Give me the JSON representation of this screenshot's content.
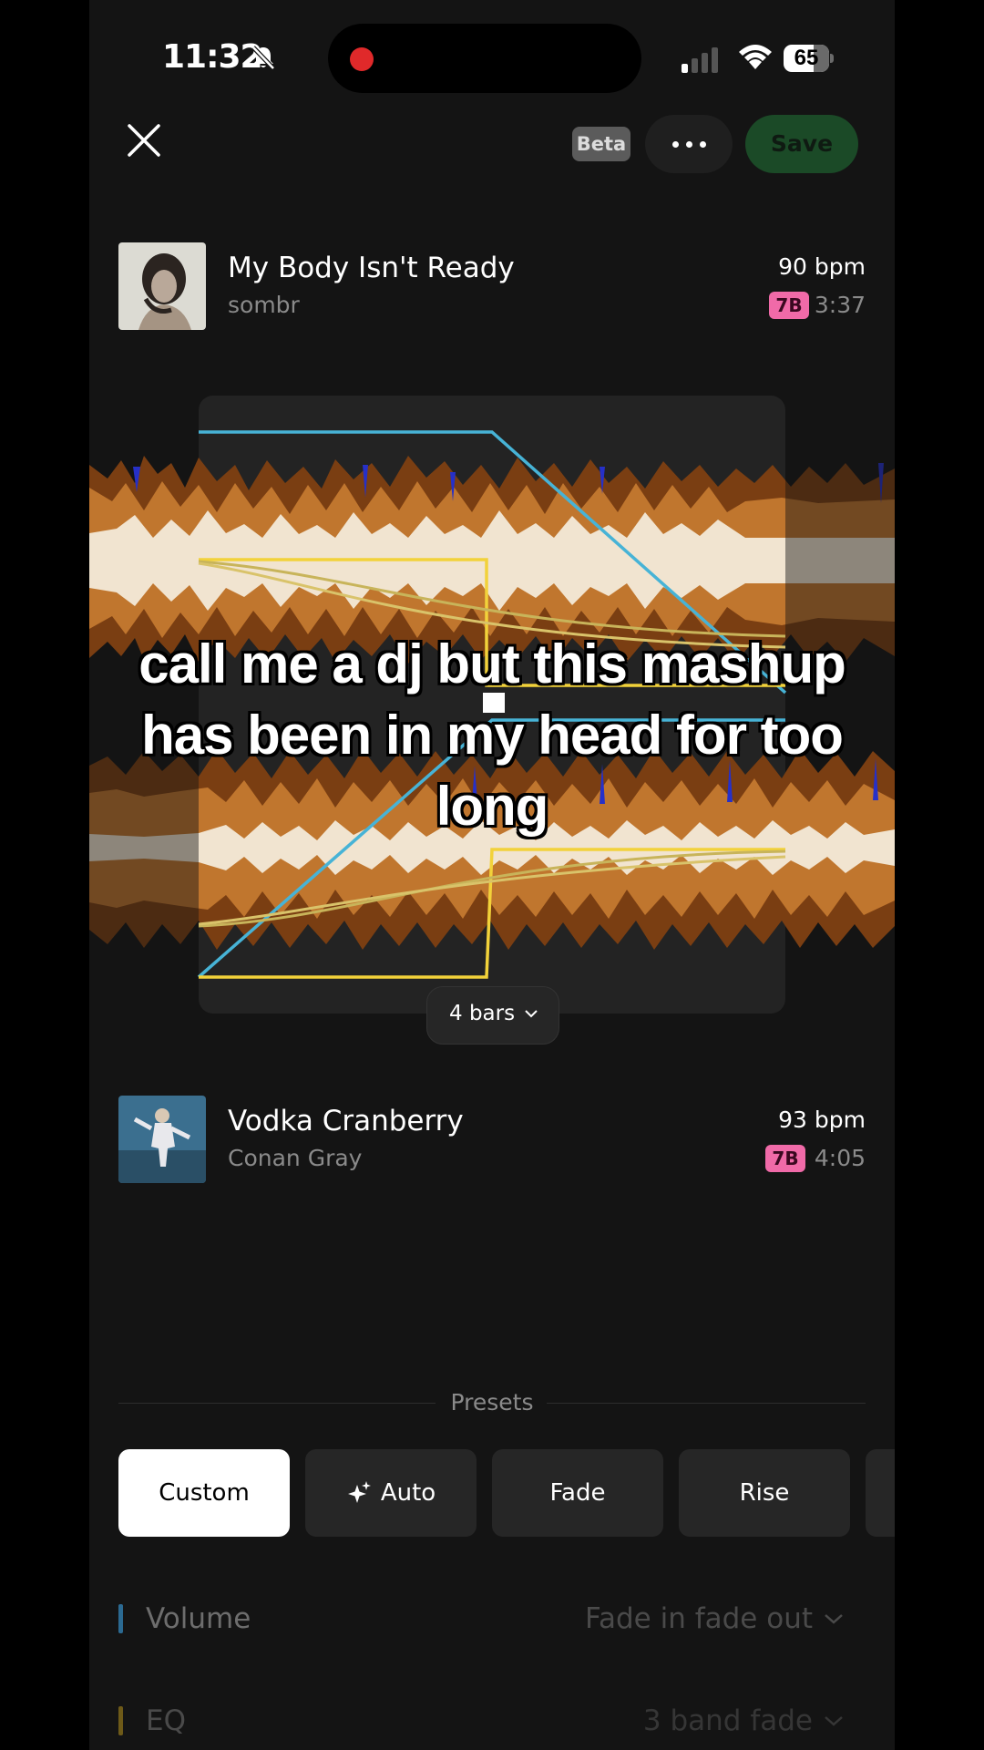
{
  "status_bar": {
    "time": "11:32",
    "battery": "65"
  },
  "toolbar": {
    "beta_label": "Beta",
    "save_label": "Save"
  },
  "tracks": [
    {
      "title": "My Body Isn't Ready",
      "artist": "sombr",
      "bpm": "90 bpm",
      "key": "7B",
      "duration": "3:37"
    },
    {
      "title": "Vodka Cranberry",
      "artist": "Conan Gray",
      "bpm": "93 bpm",
      "key": "7B",
      "duration": "4:05"
    }
  ],
  "transition": {
    "length_label": "4 bars"
  },
  "caption_lines": [
    "call me a dj but this mashup",
    "has been in my head for too",
    "long"
  ],
  "presets": {
    "heading": "Presets",
    "items": [
      "Custom",
      "Auto",
      "Fade",
      "Rise"
    ],
    "selected": "Custom"
  },
  "settings": [
    {
      "label": "Volume",
      "value": "Fade in fade out",
      "color": "#3a8fc4"
    },
    {
      "label": "EQ",
      "value": "3 band fade",
      "color": "#c9a227"
    }
  ],
  "colors": {
    "save_bg": "#1b4a27",
    "key_badge": "#f06aa8",
    "volume_curve": "#47b3d6",
    "eq_curve": "#f2d23a",
    "wave_dark": "#7a3e12",
    "wave_mid": "#c0762e",
    "wave_light": "#f1e4d0"
  }
}
